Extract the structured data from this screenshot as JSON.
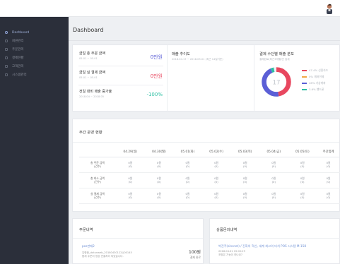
{
  "brand": {
    "text": "마켓하이네트워크"
  },
  "sidebar": {
    "items": [
      {
        "label": "Dashboard",
        "active": true
      },
      {
        "label": "회원관리",
        "active": false
      },
      {
        "label": "주문관리",
        "active": false
      },
      {
        "label": "결제현황",
        "active": false
      },
      {
        "label": "고객관리",
        "active": false
      },
      {
        "label": "시스템관리",
        "active": false
      }
    ]
  },
  "page": {
    "title": "Dashboard"
  },
  "stats": [
    {
      "label": "금일 총 주문 금액",
      "sub": "05.01 ~ 05.01",
      "value": "0만원",
      "color": "#5b5fd6"
    },
    {
      "label": "금일 실 결제 금액",
      "sub": "05.01 ~ 05.01",
      "value": "0만원",
      "color": "#e8475f"
    },
    {
      "label": "전일 대비 매출 증가율",
      "sub": "2018.04 ~ 2018.05",
      "value": "-100%",
      "color": "#2dbfa3"
    }
  ],
  "sales_trend": {
    "title": "매출 추이도",
    "sub": "2018.04.17 ~ 2018.05.01 (최근 14일기준)"
  },
  "payment_dist": {
    "title": "결제 수단별 매출 분포",
    "sub": "결제완료(최근3개월)만 집계",
    "center": "17",
    "legend": [
      {
        "label": "47.4% 신용카드",
        "color": "#e8475f",
        "pct": 47.4
      },
      {
        "label": "0% 계좌이체",
        "color": "#f3a845",
        "pct": 0
      },
      {
        "label": "46% 가상계좌",
        "color": "#5b5fd6",
        "pct": 46
      },
      {
        "label": "3.6% 핸드폰",
        "color": "#2dbfa3",
        "pct": 3.6
      }
    ]
  },
  "weekly": {
    "title": "주간 운영 현황",
    "headers": [
      "",
      "04.29(일)",
      "04.30(월)",
      "05.01(화)",
      "05.02(수)",
      "05.03(목)",
      "05.04(금)",
      "05.05(토)",
      "주간합계"
    ],
    "rows": [
      {
        "head": [
          "총 주문 금액",
          "(건수)"
        ],
        "cells": [
          "0원",
          "0원",
          "0원",
          "0원",
          "0원",
          "0원",
          "0원",
          "0원"
        ],
        "counts": [
          "(0)",
          "(0)",
          "(0)",
          "(0)",
          "(0)",
          "(0)",
          "(0)",
          "(0)"
        ]
      },
      {
        "head": [
          "총 최소 금액",
          "(건수)"
        ],
        "cells": [
          "0원",
          "0원",
          "0원",
          "0원",
          "0원",
          "0원",
          "0원",
          "0원"
        ],
        "counts": [
          "(0)",
          "(0)",
          "(0)",
          "(0)",
          "(0)",
          "(0)",
          "(0)",
          "(0)"
        ]
      },
      {
        "head": [
          "실 결제 금액",
          "(건수)"
        ],
        "cells": [
          "0원",
          "0원",
          "0원",
          "0원",
          "0원",
          "0원",
          "0원",
          "0원"
        ],
        "counts": [
          "(0)",
          "(0)",
          "(0)",
          "(0)",
          "(0)",
          "(0)",
          "(0)",
          "(0)"
        ]
      }
    ]
  },
  "orders": {
    "title": "주문내역",
    "item_link": "pos판매2",
    "item_meta": "유형중_dotunweb_20180430122()00145",
    "item_desc": "합계 주문이 정상 연결처리 되었습니다.",
    "amount": "100원",
    "status": "결제 완료"
  },
  "inquiries": {
    "title": "상품문의내역",
    "item_link": "박진주(sinsnet) / 진화의 혁신, 세계 최고의 터치 POS 시스템 M-158",
    "item_date": "2018.04.01 15:00:29",
    "item_text": "포장은 가능이 하나요?"
  }
}
